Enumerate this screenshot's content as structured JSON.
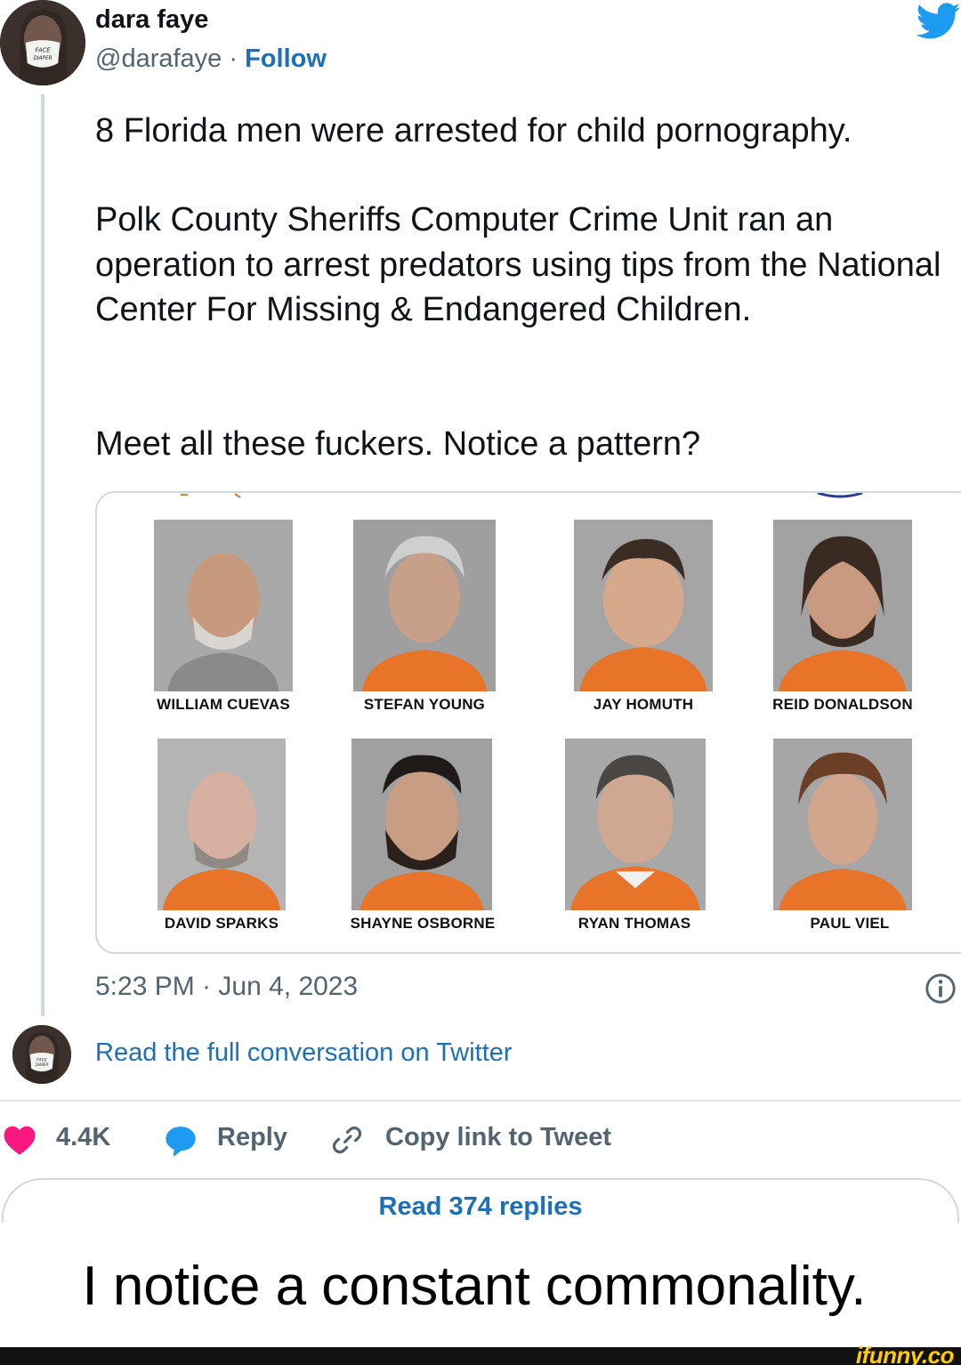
{
  "tweet": {
    "author": {
      "display_name": "dara faye",
      "handle": "@darafaye",
      "separator": " · ",
      "follow_label": "Follow",
      "avatar_icon": "masked-woman-avatar"
    },
    "paragraphs": [
      "8 Florida men were arrested for child pornography.",
      "Polk County Sheriffs Computer Crime Unit ran an operation to arrest predators using tips from the National Center For Missing & Endangered Children.",
      "Meet all these fuckers. Notice a pattern?"
    ],
    "media": {
      "mugshots": [
        {
          "name": "WILLIAM CUEVAS"
        },
        {
          "name": "STEFAN YOUNG"
        },
        {
          "name": "JAY HOMUTH"
        },
        {
          "name": "REID DONALDSON"
        },
        {
          "name": "DAVID SPARKS"
        },
        {
          "name": "SHAYNE OSBORNE"
        },
        {
          "name": "RYAN THOMAS"
        },
        {
          "name": "PAUL VIEL"
        }
      ]
    },
    "timestamp": "5:23 PM · Jun 4, 2023",
    "read_conversation_label": "Read the full conversation on Twitter",
    "actions": {
      "like_count": "4.4K",
      "reply_label": "Reply",
      "copy_link_label": "Copy link to Tweet"
    },
    "read_replies_label": "Read 374 replies"
  },
  "caption": "I notice a constant commonality.",
  "watermark": "ifunny.co",
  "colors": {
    "link_blue": "#1d6fb8",
    "twitter_blue": "#1d9bf0",
    "heart_pink": "#f91880",
    "muted_gray": "#536471",
    "prison_orange": "#e8742a"
  }
}
